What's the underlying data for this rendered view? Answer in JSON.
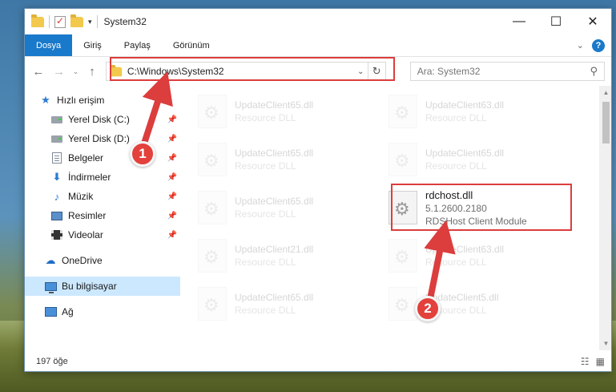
{
  "window": {
    "title": "System32",
    "controls": {
      "minimize": "—",
      "maximize": "☐",
      "close": "✕"
    }
  },
  "ribbon": {
    "tabs": [
      "Dosya",
      "Giriş",
      "Paylaş",
      "Görünüm"
    ],
    "collapse": "⌄",
    "help": "?"
  },
  "navigation": {
    "back": "←",
    "forward": "→",
    "recent": "⌄",
    "up": "↑",
    "address": "C:\\Windows\\System32",
    "address_drop": "⌄",
    "refresh": "↻",
    "search_placeholder": "Ara: System32",
    "search_icon": "⚲"
  },
  "sidebar": {
    "quick_access": "Hızlı erişim",
    "items": [
      {
        "label": "Yerel Disk (C:)",
        "icon": "drive-icon"
      },
      {
        "label": "Yerel Disk (D:)",
        "icon": "drive-icon"
      },
      {
        "label": "Belgeler",
        "icon": "documents-icon"
      },
      {
        "label": "İndirmeler",
        "icon": "downloads-icon"
      },
      {
        "label": "Müzik",
        "icon": "music-icon"
      },
      {
        "label": "Resimler",
        "icon": "pictures-icon"
      },
      {
        "label": "Videolar",
        "icon": "videos-icon"
      }
    ],
    "pin": "📌",
    "onedrive": "OneDrive",
    "this_pc": "Bu bilgisayar",
    "network": "Ağ"
  },
  "files": {
    "left": [
      {
        "name": "UpdateClient65.dll",
        "desc": "Resource DLL"
      },
      {
        "name": "UpdateClient65.dll",
        "desc": "Resource DLL"
      },
      {
        "name": "UpdateClient65.dll",
        "desc": "Resource DLL"
      },
      {
        "name": "UpdateClient21.dll",
        "desc": "Resource DLL"
      },
      {
        "name": "UpdateClient65.dll",
        "desc": "Resource DLL"
      }
    ],
    "right": [
      {
        "name": "UpdateClient63.dll",
        "desc": "Resource DLL"
      },
      {
        "name": "UpdateClient65.dll",
        "desc": "Resource DLL"
      },
      {
        "name": "UpdateClient63.dll",
        "desc": "Resource DLL"
      },
      {
        "name": "UpdateClient5.dll",
        "desc": "Resource DLL"
      }
    ],
    "highlighted": {
      "name": "rdchost.dll",
      "version": "5.1.2600.2180",
      "desc": "RDSHost Client Module"
    }
  },
  "status": {
    "count": "197 öğe",
    "details_view": "☷",
    "tiles_view": "▦"
  },
  "annotations": {
    "step1": "1",
    "step2": "2",
    "accent": "#dc3d3d"
  }
}
